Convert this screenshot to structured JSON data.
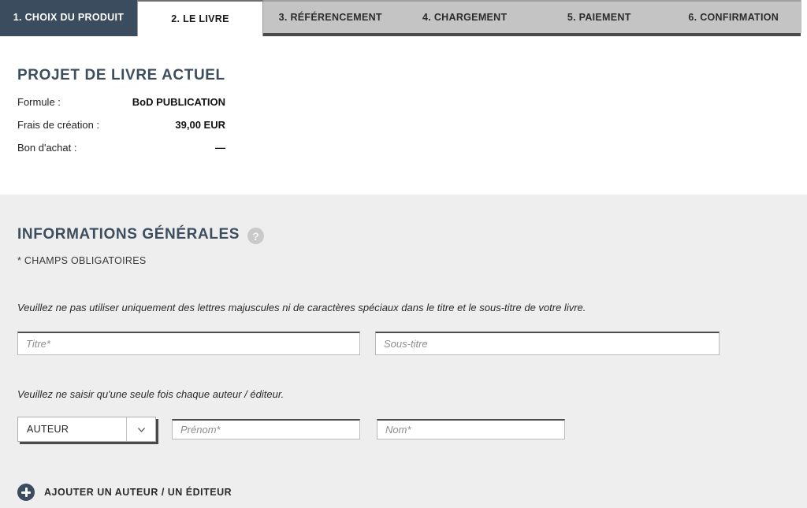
{
  "tabs": [
    {
      "label": "1. CHOIX DU PRODUIT",
      "state": "current"
    },
    {
      "label": "2. LE LIVRE",
      "state": "active"
    },
    {
      "label": "3. RÉFÉRENCEMENT",
      "state": "idle"
    },
    {
      "label": "4. CHARGEMENT",
      "state": "idle"
    },
    {
      "label": "5. PAIEMENT",
      "state": "idle"
    },
    {
      "label": "6. CONFIRMATION",
      "state": "idle"
    }
  ],
  "project": {
    "title": "PROJET DE LIVRE ACTUEL",
    "rows": [
      {
        "label": "Formule :",
        "value": "BoD PUBLICATION"
      },
      {
        "label": "Frais de création :",
        "value": "39,00 EUR"
      },
      {
        "label": "Bon d'achat :",
        "value": "—"
      }
    ]
  },
  "general_info": {
    "title": "INFORMATIONS GÉNÉRALES",
    "help_icon": "help-circle-icon",
    "help_glyph": "?",
    "required_note": "* CHAMPS OBLIGATOIRES",
    "title_hint": "Veuillez ne pas utiliser uniquement des lettres majuscules ni de caractères spéciaux dans le titre et le sous-titre de votre livre.",
    "author_hint": "Veuillez ne saisir qu'une seule fois chaque auteur / éditeur.",
    "fields": {
      "title": {
        "value": "",
        "placeholder": "Titre*"
      },
      "subtitle": {
        "value": "",
        "placeholder": "Sous-titre"
      },
      "firstname": {
        "value": "",
        "placeholder": "Prénom*"
      },
      "lastname": {
        "value": "",
        "placeholder": "Nom*"
      }
    },
    "role_select": {
      "value": "AUTEUR",
      "icon": "chevron-down-icon"
    },
    "add_button": {
      "label": "AJOUTER UN AUTEUR / UN ÉDITEUR",
      "icon": "plus-circle-icon"
    }
  },
  "colors": {
    "brand_navy": "#3a4c5e",
    "heading": "#3b4d5e",
    "tab_idle_bg": "#c4c4c4",
    "section_bg": "#eeeeee",
    "field_border_top": "#4c4c4c"
  }
}
